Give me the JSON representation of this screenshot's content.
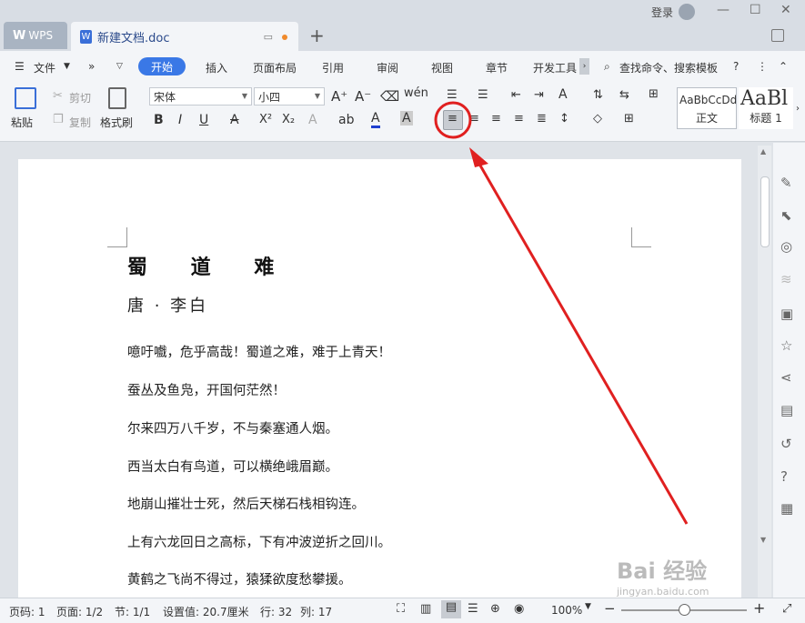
{
  "titlebar": {
    "app_tab": "WPS",
    "doc_tab": "新建文档.doc",
    "login": "登录"
  },
  "menubar": {
    "file": "文件",
    "items": [
      "开始",
      "插入",
      "页面布局",
      "引用",
      "审阅",
      "视图",
      "章节",
      "开发工具"
    ],
    "search": "查找命令、搜索模板"
  },
  "ribbon": {
    "paste": "粘贴",
    "cut": "剪切",
    "copy": "复制",
    "format_painter": "格式刷",
    "font_name": "宋体",
    "font_size": "小四",
    "styles": [
      {
        "preview": "AaBbCcDd",
        "name": "正文"
      },
      {
        "preview": "AaBl",
        "name": "标题 1"
      }
    ]
  },
  "document": {
    "title": "蜀 道 难",
    "author": "唐 · 李白",
    "lines": [
      "噫吁嚱，危乎高哉！蜀道之难，难于上青天！",
      "蚕丛及鱼凫，开国何茫然！",
      "尔来四万八千岁，不与秦塞通人烟。",
      "西当太白有鸟道，可以横绝峨眉巅。",
      "地崩山摧壮士死，然后天梯石栈相钩连。",
      "上有六龙回日之高标，下有冲波逆折之回川。",
      "黄鹤之飞尚不得过，猿猱欲度愁攀援。"
    ]
  },
  "statusbar": {
    "page_num": "页码: 1",
    "pages": "页面: 1/2",
    "section": "节: 1/1",
    "setting": "设置值: 20.7厘米",
    "row": "行: 32",
    "col": "列: 17",
    "zoom": "100%",
    "zoom_level": 0.5
  },
  "watermark": {
    "brand": "Bai 经验",
    "url": "jingyan.baidu.com"
  },
  "colors": {
    "accent": "#3a78e6",
    "annotation": "#e02020"
  }
}
